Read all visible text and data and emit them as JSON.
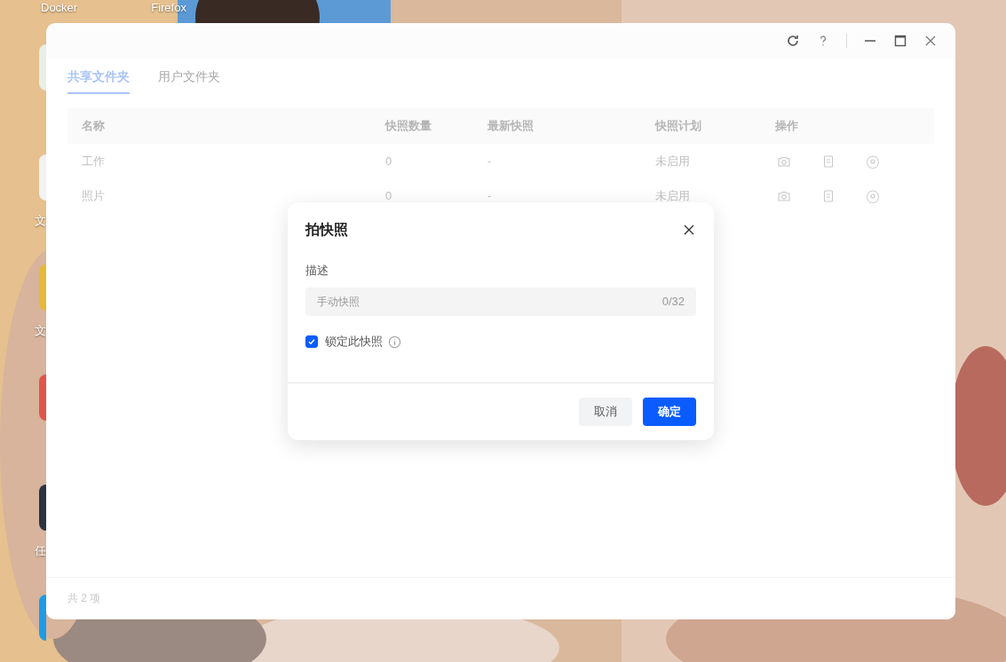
{
  "desktop": {
    "top_labels": [
      "Docker",
      "Firefox"
    ],
    "side_icons": [
      {
        "color": "#e8efe6"
      },
      {
        "label": "文",
        "color": "#f2f2f2"
      },
      {
        "label": "文",
        "color": "#e6b93a"
      },
      {
        "color": "#e0544c"
      },
      {
        "label": "任",
        "color": "#2b3440"
      },
      {
        "color": "#1e9be6"
      }
    ]
  },
  "tabs": [
    {
      "label": "共享文件夹",
      "selected": true
    },
    {
      "label": "用户文件夹",
      "selected": false
    }
  ],
  "table": {
    "columns": [
      "名称",
      "快照数量",
      "最新快照",
      "快照计划",
      "操作"
    ],
    "rows": [
      {
        "cells": [
          "工作",
          "0",
          "-",
          "未启用"
        ]
      },
      {
        "cells": [
          "照片",
          "0",
          "-",
          "未启用"
        ]
      }
    ]
  },
  "footer": "共 2 项",
  "dialog": {
    "title": "拍快照",
    "field_label": "描述",
    "placeholder": "手动快照",
    "counter": "0/32",
    "checkbox": {
      "label": "锁定此快照",
      "checked": true
    },
    "buttons": [
      {
        "label": "取消",
        "kind": "secondary"
      },
      {
        "label": "确定",
        "kind": "primary"
      }
    ]
  }
}
